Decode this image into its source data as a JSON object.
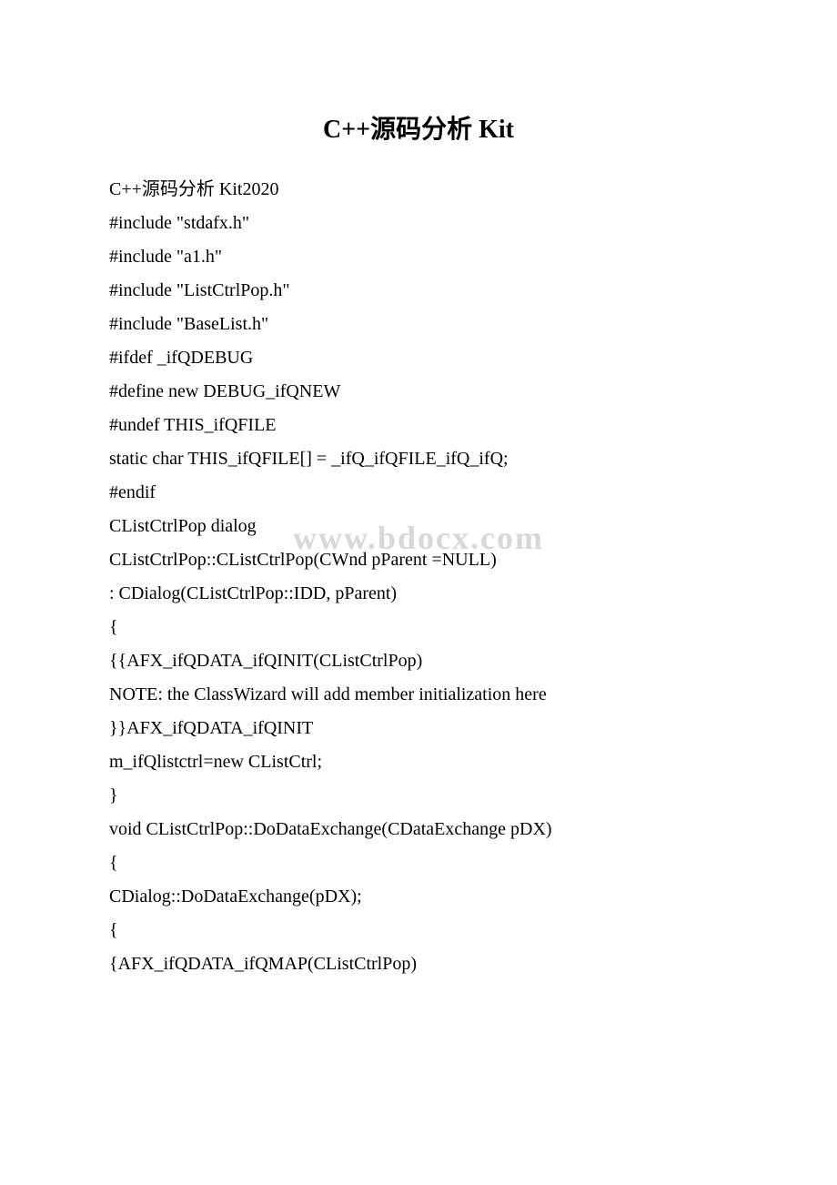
{
  "title": "C++源码分析 Kit",
  "watermark": "www.bdocx.com",
  "lines": [
    "C++源码分析 Kit2020",
    "#include \"stdafx.h\"",
    "#include \"a1.h\"",
    "#include \"ListCtrlPop.h\"",
    "#include \"BaseList.h\"",
    "#ifdef _ifQDEBUG",
    "#define new DEBUG_ifQNEW",
    "#undef THIS_ifQFILE",
    "static char THIS_ifQFILE[] = _ifQ_ifQFILE_ifQ_ifQ;",
    "#endif",
    " CListCtrlPop dialog",
    "CListCtrlPop::CListCtrlPop(CWnd pParent =NULL)",
    ": CDialog(CListCtrlPop::IDD, pParent)",
    "{",
    "{{AFX_ifQDATA_ifQINIT(CListCtrlPop)",
    " NOTE: the ClassWizard will add member initialization here",
    "}}AFX_ifQDATA_ifQINIT",
    "m_ifQlistctrl=new CListCtrl;",
    "}",
    "void CListCtrlPop::DoDataExchange(CDataExchange pDX)",
    "{",
    "CDialog::DoDataExchange(pDX);",
    "{",
    "{AFX_ifQDATA_ifQMAP(CListCtrlPop)"
  ]
}
